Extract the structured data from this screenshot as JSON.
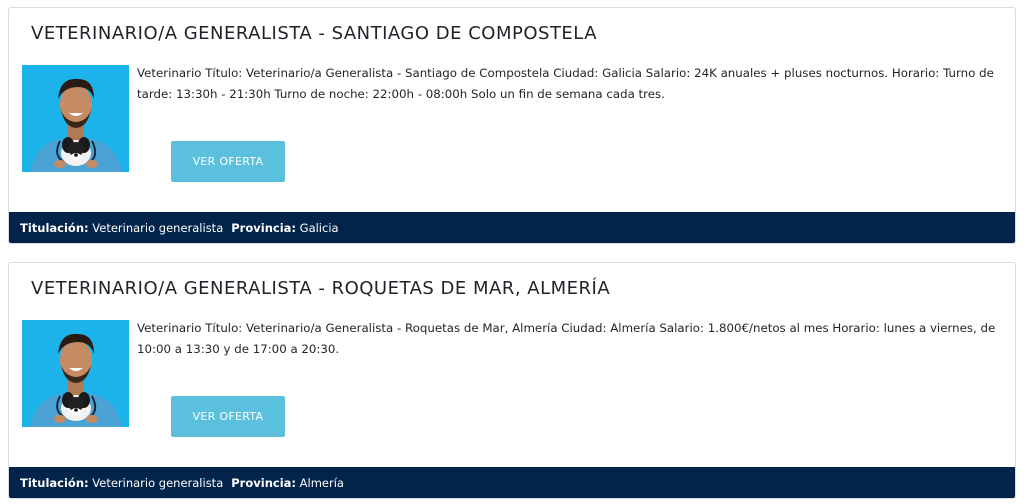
{
  "offers": [
    {
      "title": "VETERINARIO/A GENERALISTA - SANTIAGO DE COMPOSTELA",
      "description": "Veterinario  Título: Veterinario/a Generalista - Santiago de Compostela  Ciudad: Galicia  Salario: 24K anuales + pluses nocturnos.  Horario: Turno de tarde: 13:30h - 21:30h Turno de noche: 22:00h - 08:00h Solo un fin de semana cada tres.",
      "button_label": "VER OFERTA",
      "titulacion_label": "Titulación:",
      "titulacion_value": "Veterinario generalista",
      "provincia_label": "Provincia:",
      "provincia_value": "Galicia",
      "image_icon": "veterinarian-with-puppy-photo"
    },
    {
      "title": "VETERINARIO/A GENERALISTA - ROQUETAS DE MAR, ALMERÍA",
      "description": "Veterinario  Título: Veterinario/a Generalista - Roquetas de Mar, Almería  Ciudad: Almería  Salario: 1.800€/netos al mes  Horario: lunes a viernes, de 10:00 a 13:30 y de 17:00 a 20:30.",
      "button_label": "VER OFERTA",
      "titulacion_label": "Titulación:",
      "titulacion_value": "Veterinario generalista",
      "provincia_label": "Provincia:",
      "provincia_value": "Almería",
      "image_icon": "veterinarian-with-puppy-photo"
    }
  ],
  "colors": {
    "footer_bg": "#02244a",
    "button_bg": "#5bc0de",
    "photo_bg": "#1cb3ea"
  }
}
